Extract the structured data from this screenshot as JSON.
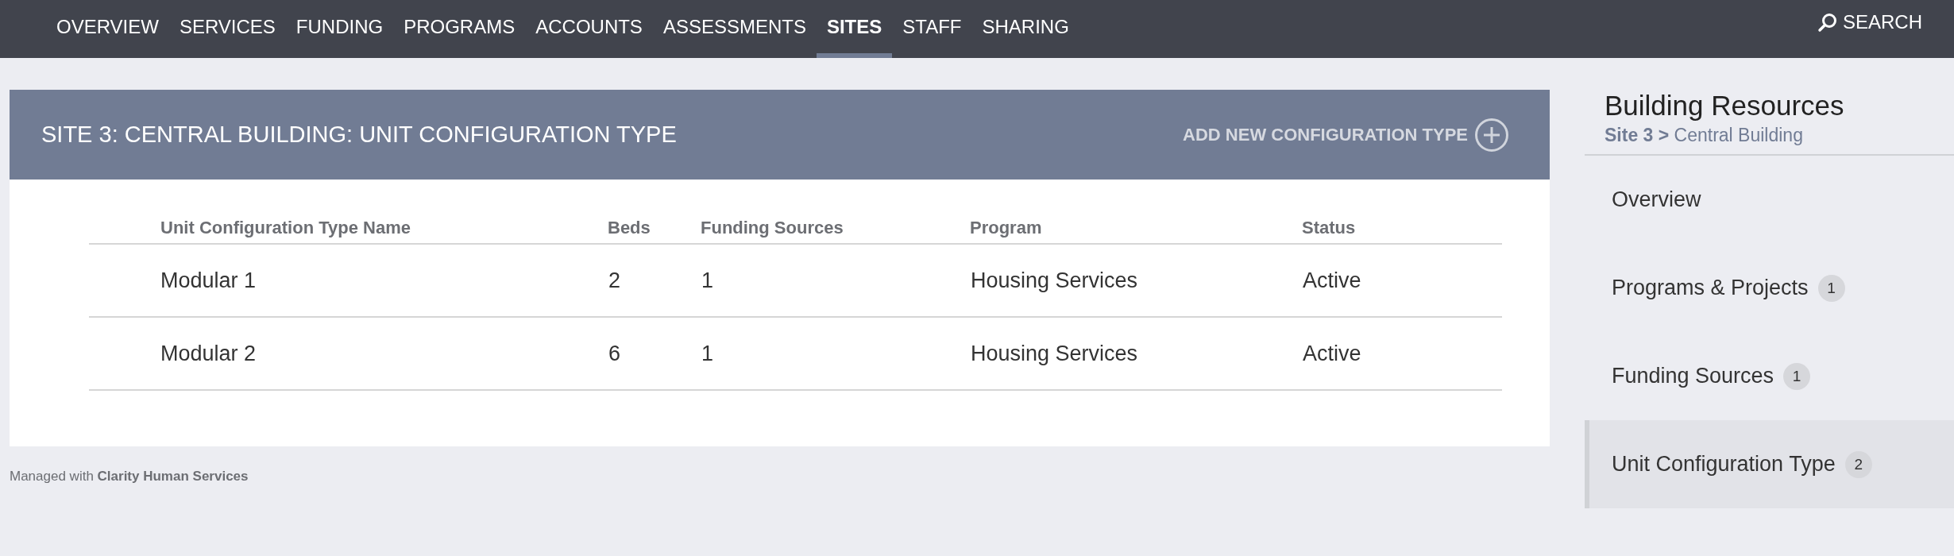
{
  "nav": {
    "tabs": [
      {
        "label": "OVERVIEW",
        "selected": false
      },
      {
        "label": "SERVICES",
        "selected": false
      },
      {
        "label": "FUNDING",
        "selected": false
      },
      {
        "label": "PROGRAMS",
        "selected": false
      },
      {
        "label": "ACCOUNTS",
        "selected": false
      },
      {
        "label": "ASSESSMENTS",
        "selected": false
      },
      {
        "label": "SITES",
        "selected": true
      },
      {
        "label": "STAFF",
        "selected": false
      },
      {
        "label": "SHARING",
        "selected": false
      }
    ],
    "search": "SEARCH"
  },
  "panel": {
    "title": "SITE 3: CENTRAL BUILDING: UNIT CONFIGURATION TYPE",
    "add_button": "ADD NEW CONFIGURATION TYPE"
  },
  "table": {
    "columns": [
      "Unit Configuration Type Name",
      "Beds",
      "Funding Sources",
      "Program",
      "Status"
    ],
    "rows": [
      [
        "Modular 1",
        "2",
        "1",
        "Housing Services",
        "Active"
      ],
      [
        "Modular 2",
        "6",
        "1",
        "Housing Services",
        "Active"
      ]
    ]
  },
  "footer": "Managed with **Clarity Human Services**",
  "sidebar": {
    "title": "Building Resources",
    "breadcrumb": "**Site 3 >** Central Building",
    "items": [
      {
        "label": "Overview",
        "selected": false
      },
      {
        "label": "Programs & Projects",
        "count": "1",
        "selected": false
      },
      {
        "label": "Funding Sources",
        "count": "1",
        "selected": false
      },
      {
        "label": "Unit Configuration Type",
        "count": "2",
        "selected": true
      }
    ]
  }
}
